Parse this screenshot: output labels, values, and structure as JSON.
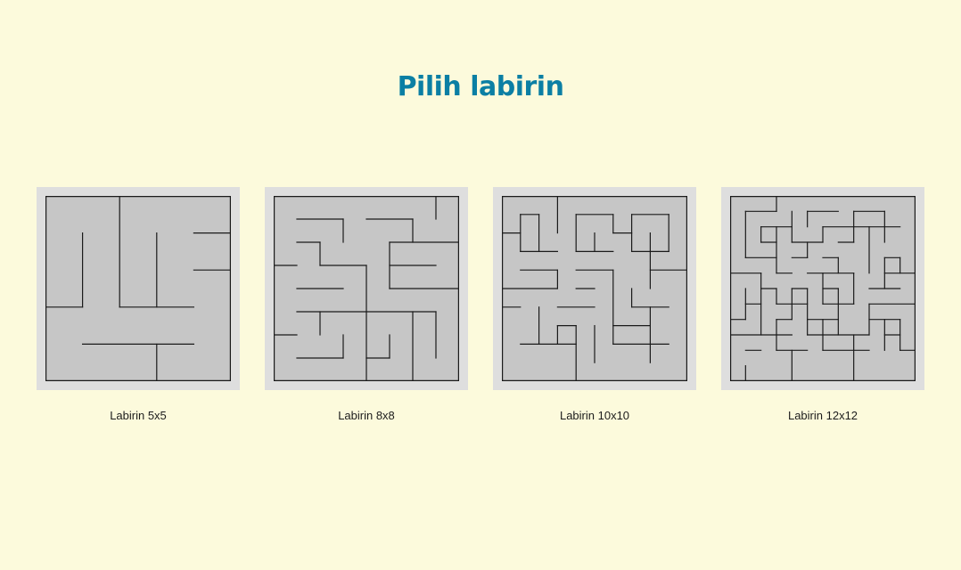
{
  "page": {
    "title": "Pilih labirin"
  },
  "colors": {
    "background": "#fcfadc",
    "title": "#0b7fa4",
    "card_frame": "#dedede",
    "maze_fill": "#c6c6c6",
    "maze_wall": "#1a1a1a"
  },
  "mazes": [
    {
      "label": "Labirin 5x5",
      "grid": 5,
      "h_walls": [
        [
          0,
          0,
          5
        ],
        [
          1,
          4,
          5
        ],
        [
          2,
          4,
          5
        ],
        [
          3,
          0,
          1
        ],
        [
          3,
          2,
          4
        ],
        [
          4,
          1,
          4
        ],
        [
          5,
          0,
          5
        ]
      ],
      "v_walls": [
        [
          0,
          0,
          5
        ],
        [
          1,
          1,
          3
        ],
        [
          2,
          0,
          3
        ],
        [
          3,
          1,
          3
        ],
        [
          3,
          4,
          5
        ],
        [
          5,
          0,
          5
        ]
      ]
    },
    {
      "label": "Labirin 8x8",
      "grid": 8,
      "h_walls": [
        [
          0,
          0,
          8
        ],
        [
          1,
          1,
          3
        ],
        [
          1,
          4,
          6
        ],
        [
          2,
          1,
          2
        ],
        [
          2,
          5,
          8
        ],
        [
          3,
          0,
          1
        ],
        [
          3,
          2,
          4
        ],
        [
          3,
          5,
          7
        ],
        [
          4,
          1,
          3
        ],
        [
          4,
          5,
          8
        ],
        [
          5,
          1,
          7
        ],
        [
          6,
          0,
          1
        ],
        [
          7,
          1,
          3
        ],
        [
          7,
          4,
          5
        ],
        [
          8,
          0,
          8
        ]
      ],
      "v_walls": [
        [
          0,
          0,
          8
        ],
        [
          2,
          2,
          3
        ],
        [
          2,
          5,
          6
        ],
        [
          3,
          1,
          2
        ],
        [
          3,
          6,
          7
        ],
        [
          4,
          3,
          5
        ],
        [
          4,
          5,
          8
        ],
        [
          5,
          2,
          4
        ],
        [
          5,
          6,
          7
        ],
        [
          6,
          1,
          2
        ],
        [
          6,
          5,
          8
        ],
        [
          7,
          0,
          1
        ],
        [
          7,
          5,
          7
        ],
        [
          8,
          0,
          8
        ]
      ]
    },
    {
      "label": "Labirin 10x10",
      "grid": 10,
      "h_walls": [
        [
          0,
          0,
          10
        ],
        [
          1,
          1,
          2
        ],
        [
          1,
          4,
          6
        ],
        [
          1,
          7,
          9
        ],
        [
          2,
          0,
          1
        ],
        [
          2,
          6,
          7
        ],
        [
          3,
          1,
          3
        ],
        [
          3,
          4,
          6
        ],
        [
          3,
          7,
          9
        ],
        [
          4,
          1,
          3
        ],
        [
          4,
          4,
          6
        ],
        [
          4,
          8,
          10
        ],
        [
          5,
          0,
          3
        ],
        [
          5,
          4,
          5
        ],
        [
          6,
          0,
          1
        ],
        [
          6,
          3,
          5
        ],
        [
          6,
          7,
          9
        ],
        [
          7,
          3,
          4
        ],
        [
          7,
          6,
          8
        ],
        [
          8,
          1,
          4
        ],
        [
          8,
          6,
          9
        ],
        [
          10,
          0,
          10
        ]
      ],
      "v_walls": [
        [
          0,
          0,
          10
        ],
        [
          1,
          1,
          3
        ],
        [
          2,
          1,
          3
        ],
        [
          2,
          6,
          8
        ],
        [
          3,
          0,
          2
        ],
        [
          3,
          4,
          5
        ],
        [
          3,
          7,
          8
        ],
        [
          4,
          1,
          3
        ],
        [
          4,
          7,
          10
        ],
        [
          5,
          2,
          3
        ],
        [
          5,
          7,
          9
        ],
        [
          6,
          1,
          2
        ],
        [
          6,
          4,
          8
        ],
        [
          7,
          1,
          3
        ],
        [
          7,
          5,
          6
        ],
        [
          8,
          2,
          5
        ],
        [
          8,
          6,
          9
        ],
        [
          9,
          1,
          3
        ],
        [
          10,
          0,
          10
        ]
      ]
    },
    {
      "label": "Labirin 12x12",
      "grid": 12,
      "h_walls": [
        [
          0,
          0,
          12
        ],
        [
          1,
          1,
          3
        ],
        [
          1,
          5,
          7
        ],
        [
          1,
          8,
          10
        ],
        [
          2,
          2,
          4
        ],
        [
          2,
          6,
          11
        ],
        [
          3,
          2,
          3
        ],
        [
          3,
          4,
          6
        ],
        [
          3,
          7,
          8
        ],
        [
          4,
          1,
          3
        ],
        [
          4,
          4,
          5
        ],
        [
          4,
          6,
          7
        ],
        [
          4,
          10,
          11
        ],
        [
          5,
          0,
          2
        ],
        [
          5,
          3,
          4
        ],
        [
          5,
          5,
          8
        ],
        [
          5,
          10,
          12
        ],
        [
          6,
          2,
          3
        ],
        [
          6,
          4,
          5
        ],
        [
          6,
          6,
          7
        ],
        [
          6,
          9,
          11
        ],
        [
          7,
          1,
          2
        ],
        [
          7,
          3,
          5
        ],
        [
          7,
          6,
          8
        ],
        [
          7,
          9,
          12
        ],
        [
          8,
          0,
          1
        ],
        [
          8,
          3,
          4
        ],
        [
          8,
          5,
          7
        ],
        [
          8,
          9,
          11
        ],
        [
          9,
          0,
          4
        ],
        [
          9,
          5,
          9
        ],
        [
          9,
          10,
          11
        ],
        [
          10,
          1,
          2
        ],
        [
          10,
          3,
          5
        ],
        [
          10,
          6,
          9
        ],
        [
          10,
          11,
          12
        ],
        [
          12,
          0,
          12
        ]
      ],
      "v_walls": [
        [
          0,
          0,
          12
        ],
        [
          1,
          1,
          4
        ],
        [
          1,
          6,
          8
        ],
        [
          1,
          11,
          12
        ],
        [
          2,
          2,
          3
        ],
        [
          2,
          5,
          9
        ],
        [
          3,
          0,
          1
        ],
        [
          3,
          2,
          5
        ],
        [
          3,
          6,
          7
        ],
        [
          3,
          8,
          10
        ],
        [
          4,
          1,
          3
        ],
        [
          4,
          6,
          8
        ],
        [
          4,
          10,
          12
        ],
        [
          5,
          1,
          2
        ],
        [
          5,
          3,
          4
        ],
        [
          5,
          6,
          9
        ],
        [
          6,
          2,
          3
        ],
        [
          6,
          5,
          7
        ],
        [
          6,
          8,
          10
        ],
        [
          7,
          4,
          5
        ],
        [
          7,
          6,
          9
        ],
        [
          8,
          1,
          3
        ],
        [
          8,
          5,
          7
        ],
        [
          8,
          9,
          12
        ],
        [
          9,
          2,
          5
        ],
        [
          9,
          7,
          9
        ],
        [
          10,
          1,
          3
        ],
        [
          10,
          4,
          6
        ],
        [
          10,
          8,
          10
        ],
        [
          11,
          4,
          5
        ],
        [
          11,
          8,
          10
        ],
        [
          12,
          0,
          12
        ]
      ]
    }
  ]
}
